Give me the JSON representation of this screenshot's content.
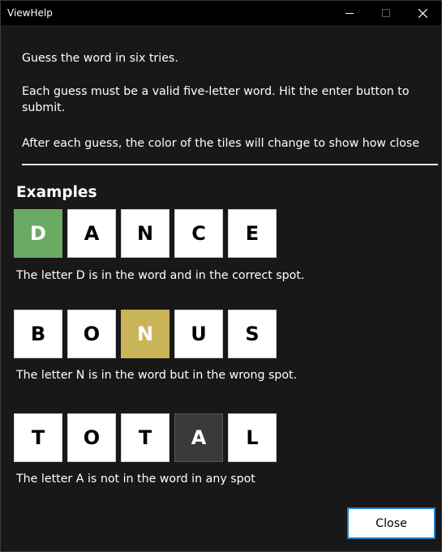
{
  "window": {
    "title": "ViewHelp"
  },
  "intro": {
    "line1": "Guess the word in six tries.",
    "line2": "Each guess must be a valid five-letter word. Hit the enter button to submit.",
    "line3": "After each guess, the color of the tiles will change to show how close"
  },
  "examples": {
    "heading": "Examples",
    "rows": [
      {
        "letters": [
          "D",
          "A",
          "N",
          "C",
          "E"
        ],
        "highlight_index": 0,
        "highlight_color": "#6aaa64",
        "explanation": "The letter D  is in the word and in the correct spot."
      },
      {
        "letters": [
          "B",
          "O",
          "N",
          "U",
          "S"
        ],
        "highlight_index": 2,
        "highlight_color": "#c9b458",
        "explanation": "The letter N  is in the word but in the wrong spot."
      },
      {
        "letters": [
          "T",
          "O",
          "T",
          "A",
          "L"
        ],
        "highlight_index": 3,
        "highlight_color": "#3a3a3c",
        "explanation": "The letter A is not in the word in any spot"
      }
    ]
  },
  "footer": {
    "close_label": "Close"
  },
  "colors": {
    "background": "#1a1718",
    "titlebar": "#000000",
    "correct": "#6aaa64",
    "present": "#c9b458",
    "absent": "#3a3a3c",
    "accent": "#1f7fd1"
  }
}
